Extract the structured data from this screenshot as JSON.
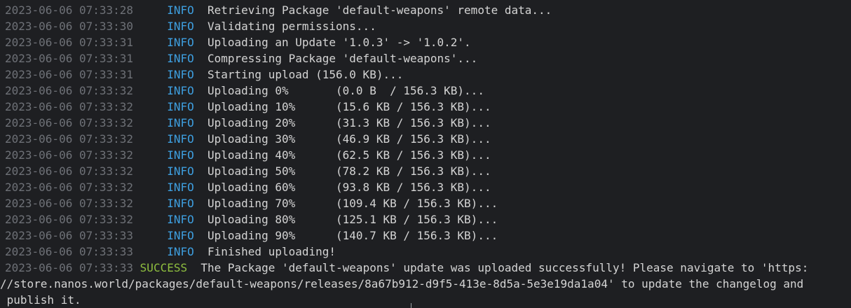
{
  "colors": {
    "background": "#1e1f22",
    "timestamp": "#6e7177",
    "info": "#3e9fe0",
    "success": "#8fbf3f",
    "text": "#d4d4d4"
  },
  "lines": [
    {
      "ts": "2023-06-06 07:33:28",
      "level": "INFO",
      "msg": "Retrieving Package 'default-weapons' remote data..."
    },
    {
      "ts": "2023-06-06 07:33:30",
      "level": "INFO",
      "msg": "Validating permissions..."
    },
    {
      "ts": "2023-06-06 07:33:31",
      "level": "INFO",
      "msg": "Uploading an Update '1.0.3' -> '1.0.2'."
    },
    {
      "ts": "2023-06-06 07:33:31",
      "level": "INFO",
      "msg": "Compressing Package 'default-weapons'..."
    },
    {
      "ts": "2023-06-06 07:33:31",
      "level": "INFO",
      "msg": "Starting upload (156.0 KB)..."
    },
    {
      "ts": "2023-06-06 07:33:32",
      "level": "INFO",
      "msg": "Uploading 0%       (0.0 B  / 156.3 KB)..."
    },
    {
      "ts": "2023-06-06 07:33:32",
      "level": "INFO",
      "msg": "Uploading 10%      (15.6 KB / 156.3 KB)..."
    },
    {
      "ts": "2023-06-06 07:33:32",
      "level": "INFO",
      "msg": "Uploading 20%      (31.3 KB / 156.3 KB)..."
    },
    {
      "ts": "2023-06-06 07:33:32",
      "level": "INFO",
      "msg": "Uploading 30%      (46.9 KB / 156.3 KB)..."
    },
    {
      "ts": "2023-06-06 07:33:32",
      "level": "INFO",
      "msg": "Uploading 40%      (62.5 KB / 156.3 KB)..."
    },
    {
      "ts": "2023-06-06 07:33:32",
      "level": "INFO",
      "msg": "Uploading 50%      (78.2 KB / 156.3 KB)..."
    },
    {
      "ts": "2023-06-06 07:33:32",
      "level": "INFO",
      "msg": "Uploading 60%      (93.8 KB / 156.3 KB)..."
    },
    {
      "ts": "2023-06-06 07:33:32",
      "level": "INFO",
      "msg": "Uploading 70%      (109.4 KB / 156.3 KB)..."
    },
    {
      "ts": "2023-06-06 07:33:32",
      "level": "INFO",
      "msg": "Uploading 80%      (125.1 KB / 156.3 KB)..."
    },
    {
      "ts": "2023-06-06 07:33:33",
      "level": "INFO",
      "msg": "Uploading 90%      (140.7 KB / 156.3 KB)..."
    },
    {
      "ts": "2023-06-06 07:33:33",
      "level": "INFO",
      "msg": "Finished uploading!"
    },
    {
      "ts": "2023-06-06 07:33:33",
      "level": "SUCCESS",
      "msg": "The Package 'default-weapons' update was uploaded successfully! Please navigate to 'https:"
    }
  ],
  "wrap": [
    "//store.nanos.world/packages/default-weapons/releases/8a67b912-d9f5-413e-8d5a-5e3e19da1a04' to update the changelog and",
    " publish it."
  ]
}
